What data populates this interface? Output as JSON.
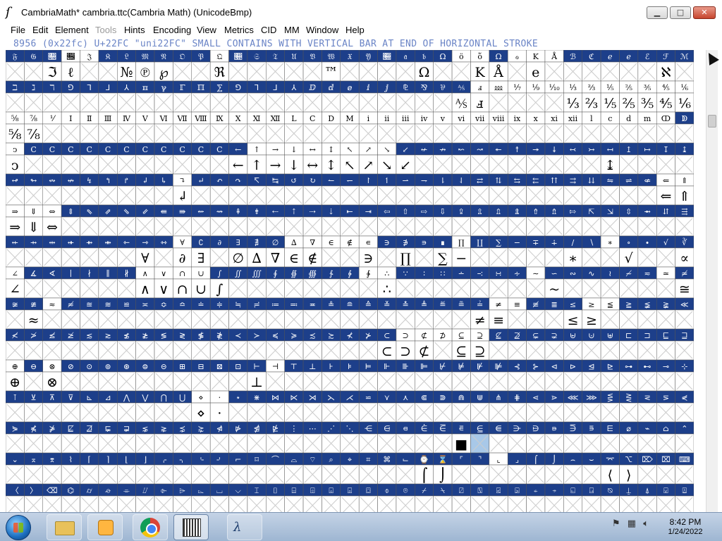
{
  "window": {
    "title": "CambriaMath*  cambria.ttc(Cambria Math) (UnicodeBmp)",
    "app_icon": "fontforge-icon",
    "controls": {
      "minimize": "minimize-icon",
      "maximize": "maximize-icon",
      "close": "close-icon"
    }
  },
  "menubar": {
    "items": [
      {
        "label": "File",
        "enabled": true
      },
      {
        "label": "Edit",
        "enabled": true
      },
      {
        "label": "Element",
        "enabled": true
      },
      {
        "label": "Tools",
        "enabled": false
      },
      {
        "label": "Hints",
        "enabled": true
      },
      {
        "label": "Encoding",
        "enabled": true
      },
      {
        "label": "View",
        "enabled": true
      },
      {
        "label": "Metrics",
        "enabled": true
      },
      {
        "label": "CID",
        "enabled": true
      },
      {
        "label": "MM",
        "enabled": true
      },
      {
        "label": "Window",
        "enabled": true
      },
      {
        "label": "Help",
        "enabled": true
      }
    ]
  },
  "glyph_info": "8956 (0x22fc) U+22FC \"uni22FC\" SMALL CONTAINS WITH VERTICAL BAR AT END OF HORIZONTAL STROKE",
  "glyph_grid": {
    "columns": 37,
    "colors": {
      "header_selected": "#1d3f8a",
      "empty_cross": "#cccccc",
      "selected_cell": "#a8c8e8",
      "cell_text": "#000000",
      "header_text": "#ffffff",
      "border": "#555555"
    },
    "rows": [
      {
        "hdr": "𝔉𝔊𝔋𝔌𝔍𝔎𝔏𝔐𝔑𝔒𝔓𝔔𝔕𝔖𝔗𝔘𝔙𝔚𝔛𝔜𝔝𝔞𝔟ΩöὅΩℴKÅℬℭℯℯℰℱℳℳℵ",
        "sel": "11100111111011111111111100100011111111",
        "g": "  ℑℓ  №℗℘  ℜ     ™    Ω  KÅ e      ℵ"
      },
      {
        "hdr": "ℶℷℸ⅁⅂⅃⅄ℼℽℾℿ⅀⅁⅂⅃⅄ⅅⅆⅇⅈⅉ⅊⅋⅌⅍ⅎ⅏⅐⅑⅒⅓⅔⅕⅖⅗⅘⅙⅚",
        "sel": "1111111111111111111111111000000000000",
        "g": "                        ⅍ⅎ    ⅓⅔⅕⅖⅗⅘⅙⅚⅛"
      },
      {
        "hdr": "⅝⅞⅟ⅠⅡⅢⅣⅤⅥⅦⅧⅨⅩⅪⅫⅬⅭⅮⅯⅰⅱⅲⅳⅴⅵⅶⅷⅸⅹⅺⅻⅼⅽⅾⅿↀↁ",
        "sel": "0000000000000000000000000000000000001",
        "g": "⅝⅞                                   "
      },
      {
        "hdr": "ↄⅭⅭⅭⅭⅭⅭⅭⅭⅭⅭⅭ←↑→↓↔↕↖↗↘↙↚↛↜↝↞↟↠↡↢↣↤↥↦↧↨↩↪",
        "sel": "0111111111111000000001111111111111111",
        "g": "ↄ           ←↑→↓↔↕↖↗↘↙          ↨    "
      },
      {
        "hdr": "↫↬↭↮↯↰↱↲↳↴↵↶↷↸↹↺↻↼↽↾↿⇀⇁⇂⇃⇄⇅⇆⇇⇈⇉⇊⇋⇌⇍⇐⇑",
        "sel": "1111111110111111111111111111111111100",
        "g": "         ↲                         ⇐⇑"
      },
      {
        "hdr": "⇒⇓⇔⇕⇖⇗⇘⇙⇚⇛⇜⇝⇞⇟⇠⇡⇢⇣⇤⇥⇦⇧⇨⇩⇪⇫⇬⇭⇮⇯⇰⇱⇲⇳⇴⇵⇶",
        "sel": "0001111111111111111111111111111111111",
        "g": "⇒⇓⇔                                  "
      },
      {
        "hdr": "⇷⇸⇹⇺⇻⇼⇽⇾⇿∀∁∂∃∄∅∆∇∈∉∊∋∌∍∎∏∐∑−∓∔∕∖∗∘∙√∛∜∝∞∟",
        "sel": "1111111110111110000011110111111101111",
        "g": "       ∀ ∂∃ ∅∆∇∈∉  ∋ ∏ ∑−     ∗  √  ∝∞"
      },
      {
        "hdr": "∠∡∢∣∤∥∦∧∨∩∪∫∬∭∮∯∰∱∲∳∴∵∶∷∸∹∺∻∼∽∾∿≀≁≂≃≄≅",
        "sel": "0111111000011111111001111111011111101",
        "g": "∠      ∧∨∩∪∫        ∴        ~      ≅"
      },
      {
        "hdr": "≆≇≈≉≊≋≌≍≎≏≐≑≒≓≔≕≖≗≘≙≚≛≜≝≞≟≠≡≢≣≤≥≦≧≨≩≪≫≬≭",
        "sel": "1101111111111111111111111100111001111",
        "g": " ≈                       ≠≡   ≤≥     "
      },
      {
        "hdr": "≮≯≰≱≲≳≴≵≶≷≸≹≺≻≼≽≾≿⊀⊁⊂⊃⊄⊅⊆⊇⊈⊉⊊⊋⊌⊍⊎⊏⊐⊑⊒",
        "sel": "1111111111111111111110000011111111111",
        "g": "                    ⊂⊃⊄ ⊆⊇          "
      },
      {
        "hdr": "⊕⊖⊗⊘⊙⊚⊛⊜⊝⊞⊟⊠⊡⊢⊣⊤⊥⊦⊧⊨⊩⊪⊫⊬⊭⊮⊯⊰⊱⊲⊳⊴⊵⊶⊷⊸⊹",
        "sel": "0101111111111101111111111111111111111",
        "g": "⊕ ⊗          ⊥                       "
      },
      {
        "hdr": "⊺⊻⊼⊽⊾⊿⋀⋁⋂⋃⋄⋅⋆⋇⋈⋉⋊⋋⋌⋍⋎⋏⋐⋑⋒⋓⋔⋕⋖⋗⋘⋙⋚⋛⋜⋝⋞",
        "sel": "1111111111001111111111111111111111111",
        "g": "          ⋄⋅                         "
      },
      {
        "hdr": "⋟⋠⋡⋢⋣⋤⋥⋦⋧⋨⋩⋪⋫⋬⋭⋮⋯⋰⋱⋲⋳⋴⋵⋶⋷⋸⋹⋺⋻⋼⋽⋾⋿⌀⌁⌂⌃",
        "sel": "1111111111111111111111111111111111111",
        "g": "                        ■            "
      },
      {
        "hdr": "⌄⌅⌆⌇⌈⌉⌊⌋⌌⌍⌎⌏⌐⌑⌒⌓⌔⌕⌖⌗⌘⌙⌚⌛⌜⌝⌞⌟⌠⌡⌢⌣⌤⌥⌦⌧⌨",
        "sel": "1111111111111111111111111101111111111",
        "g": "                      ⌠⌡        ⟨⟩   "
      },
      {
        "hdr": "〈〉⌫⌬⌭⌮⌯⌰⌱⌲⌳⌴⌵⌶⌷⌸⌹⌺⌻⌼⌽⌾⌿⍀⍁⍂⍃⍄⍅⍆⍇⍈⍉⍊⍋⍌⍍",
        "sel": "1111111111111111111111111111111111111",
        "g": "                                     "
      }
    ]
  },
  "taskbar": {
    "start": "windows-start-icon",
    "apps": [
      "folder-icon",
      "media-player-icon",
      "chrome-icon",
      "fontforge-icon",
      "terminal-icon"
    ],
    "tray_icons": [
      "flag-icon",
      "network-icon",
      "volume-icon"
    ],
    "time": "8:42 PM",
    "date": "1/24/2022"
  }
}
